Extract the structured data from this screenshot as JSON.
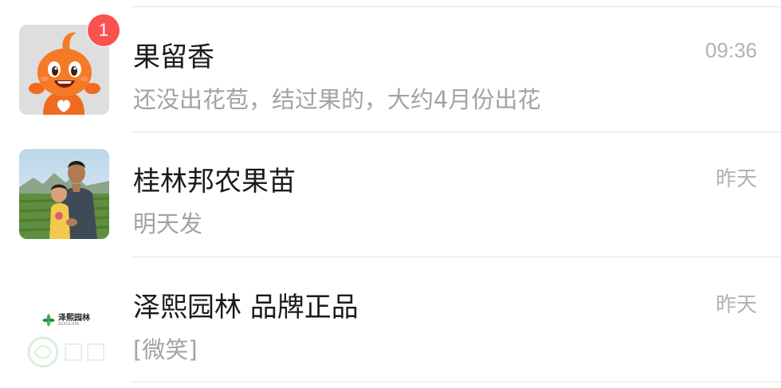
{
  "chats": [
    {
      "name": "果留香",
      "preview": "还没出花苞，结过果的，大约4月份出花",
      "time": "09:36",
      "unread": "1",
      "avatar": "orange-cartoon-mascot"
    },
    {
      "name": "桂林邦农果苗",
      "preview": "明天发",
      "time": "昨天",
      "avatar": "man-with-child-photo"
    },
    {
      "name": "泽熙园林 品牌正品",
      "preview": "[微笑]",
      "time": "昨天",
      "avatar": "zexi-garden-logo",
      "logo_text": "泽熙园林",
      "logo_subtext": "ZEXISCAPE"
    }
  ],
  "colors": {
    "badge": "#fa5151",
    "name": "#1a1a1a",
    "preview": "#a3a3a3",
    "time": "#b2b2b2",
    "divider": "#e6e6e6",
    "logo_green": "#3aa34a"
  }
}
